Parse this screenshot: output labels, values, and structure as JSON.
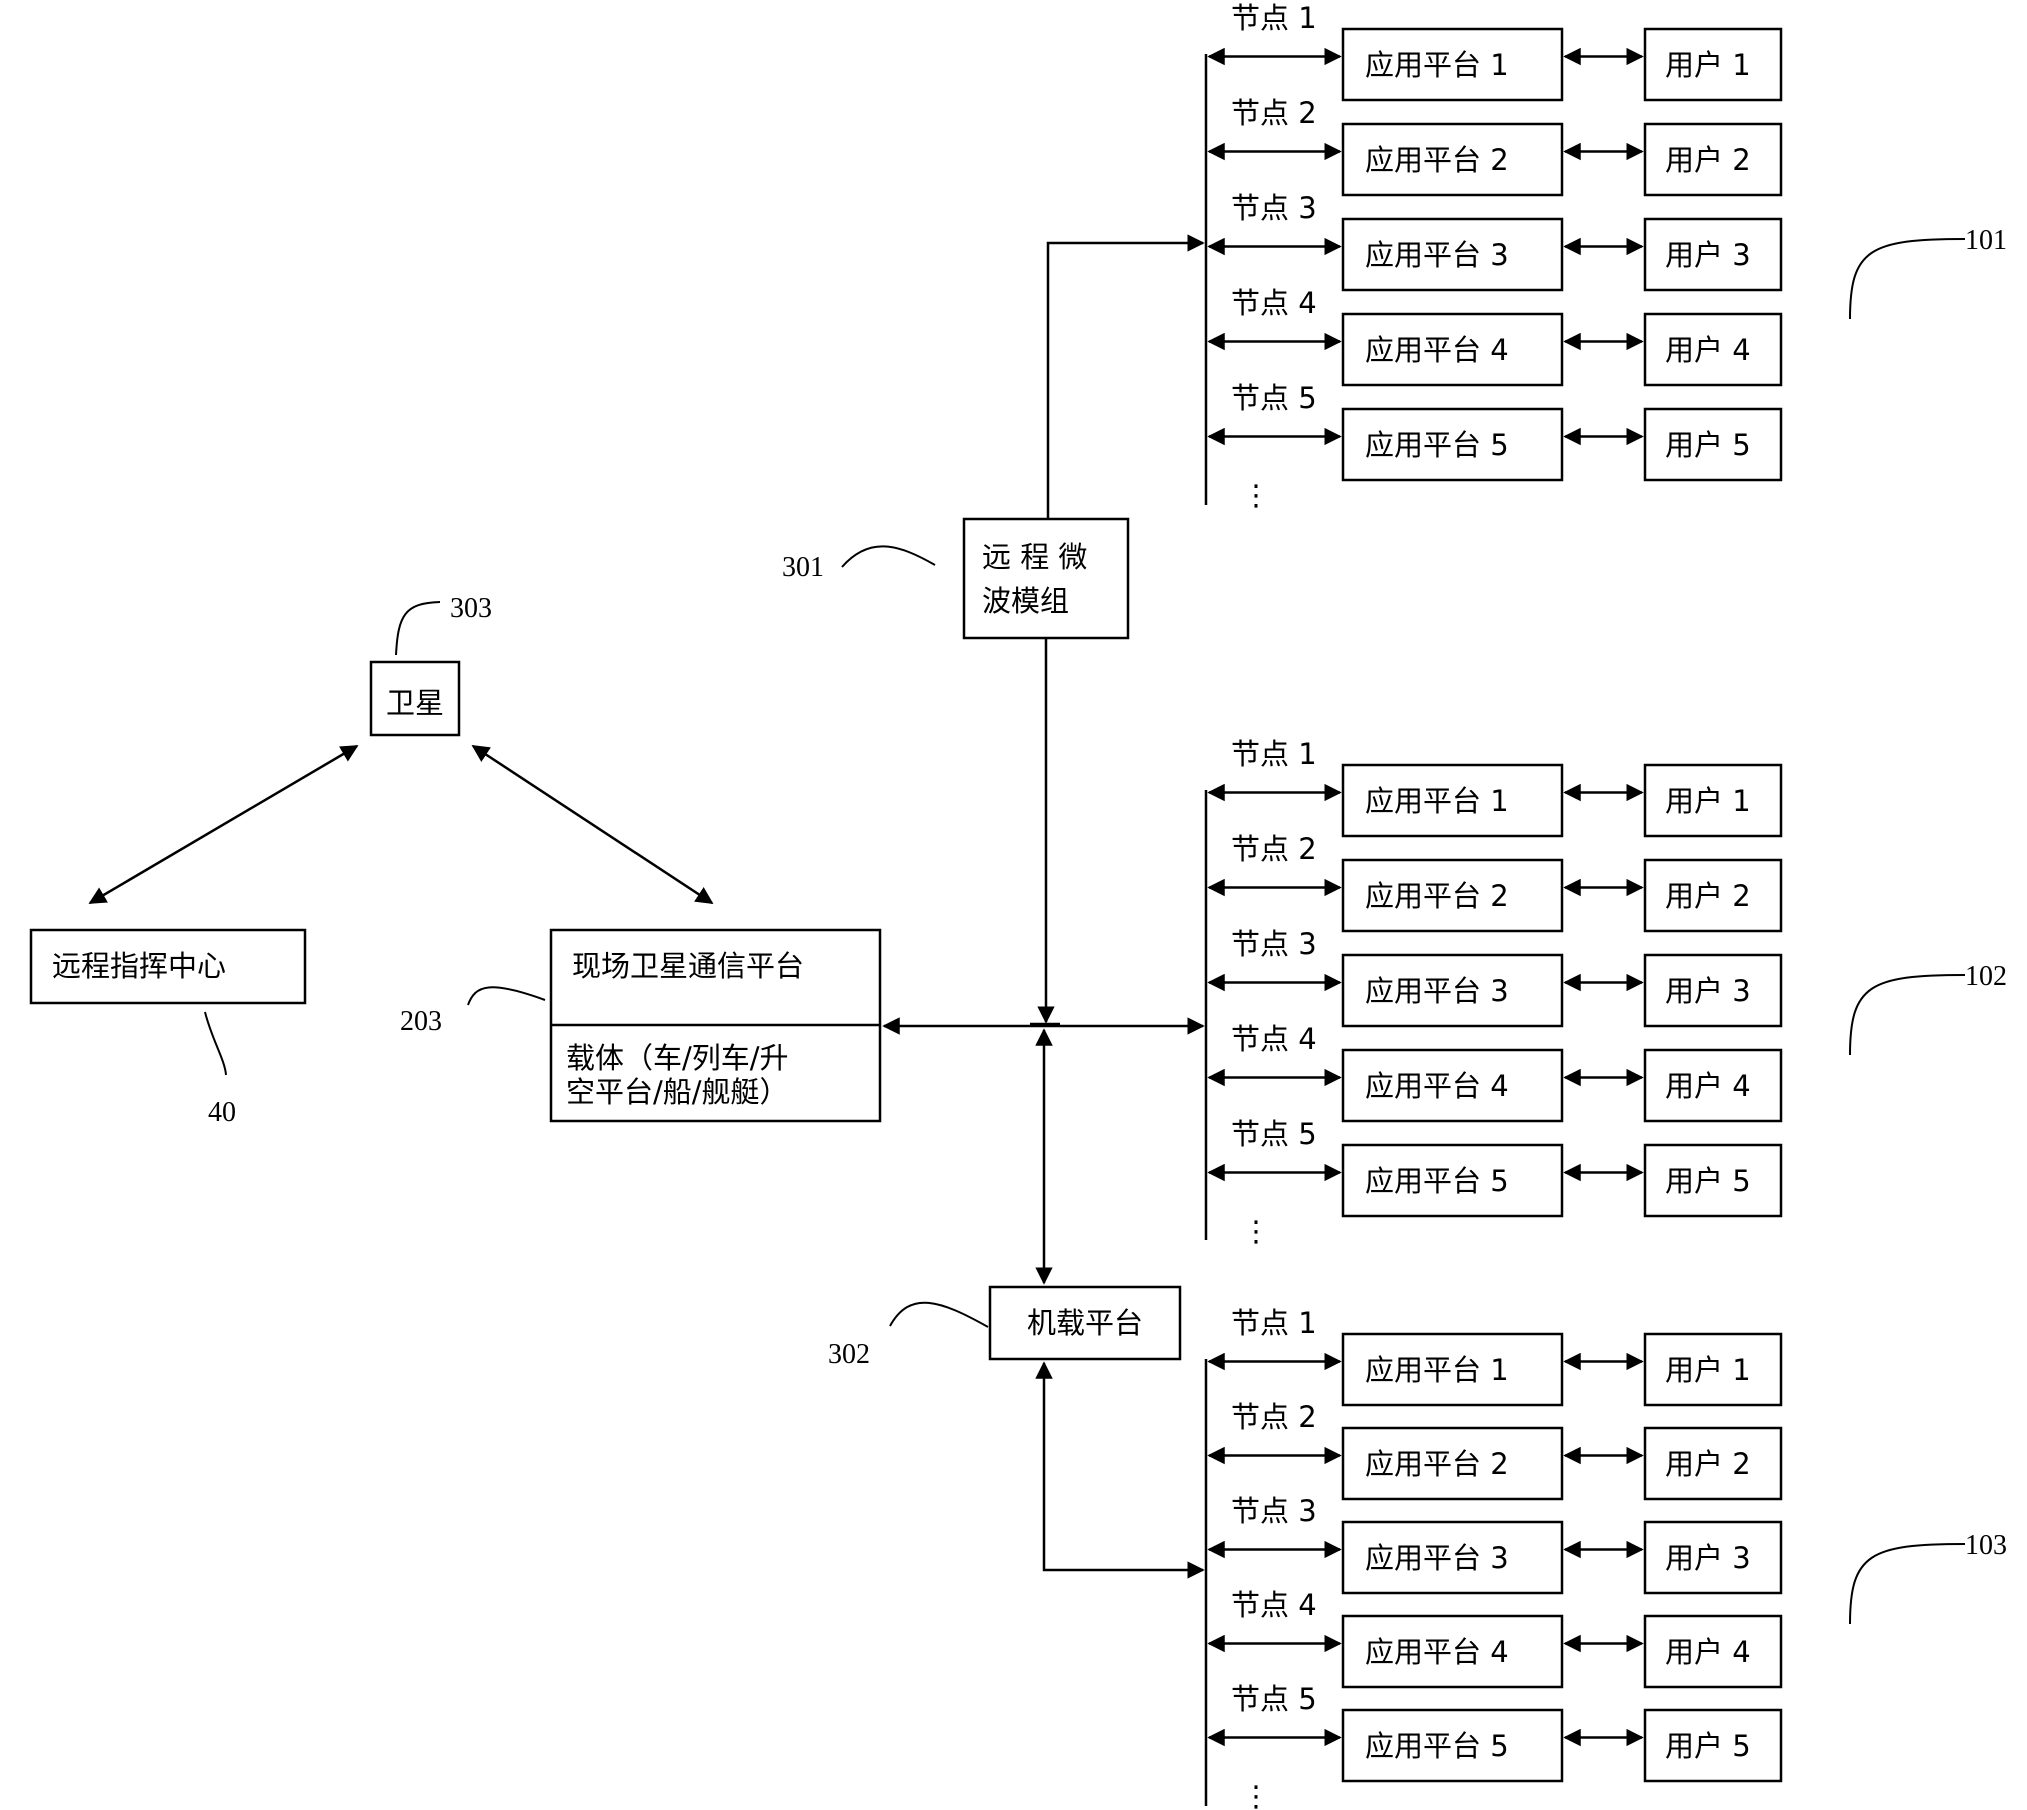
{
  "colors": {
    "stroke": "#000000",
    "background": "#ffffff"
  },
  "nodes": {
    "satellite": {
      "label": "卫星",
      "ref": "303"
    },
    "command_center": {
      "label": "远程指挥中心",
      "ref": "40"
    },
    "onsite_platform": {
      "title": "现场卫星通信平台",
      "carrier_line1": "载体（车/列车/升",
      "carrier_line2": "空平台/船/舰艇）",
      "ref": "203"
    },
    "microwave": {
      "line1": "远 程 微",
      "line2": "波模组",
      "ref": "301"
    },
    "airborne": {
      "label": "机载平台",
      "ref": "302"
    }
  },
  "groups": [
    {
      "ref": "101",
      "rows": [
        {
          "node": "节点 1",
          "app": "应用平台 1",
          "user": "用户 1"
        },
        {
          "node": "节点 2",
          "app": "应用平台 2",
          "user": "用户 2"
        },
        {
          "node": "节点 3",
          "app": "应用平台 3",
          "user": "用户 3"
        },
        {
          "node": "节点 4",
          "app": "应用平台 4",
          "user": "用户 4"
        },
        {
          "node": "节点 5",
          "app": "应用平台 5",
          "user": "用户 5"
        }
      ],
      "ellipsis": "⋮"
    },
    {
      "ref": "102",
      "rows": [
        {
          "node": "节点 1",
          "app": "应用平台 1",
          "user": "用户 1"
        },
        {
          "node": "节点 2",
          "app": "应用平台 2",
          "user": "用户 2"
        },
        {
          "node": "节点 3",
          "app": "应用平台 3",
          "user": "用户 3"
        },
        {
          "node": "节点 4",
          "app": "应用平台 4",
          "user": "用户 4"
        },
        {
          "node": "节点 5",
          "app": "应用平台 5",
          "user": "用户 5"
        }
      ],
      "ellipsis": "⋮"
    },
    {
      "ref": "103",
      "rows": [
        {
          "node": "节点 1",
          "app": "应用平台 1",
          "user": "用户 1"
        },
        {
          "node": "节点 2",
          "app": "应用平台 2",
          "user": "用户 2"
        },
        {
          "node": "节点 3",
          "app": "应用平台 3",
          "user": "用户 3"
        },
        {
          "node": "节点 4",
          "app": "应用平台 4",
          "user": "用户 4"
        },
        {
          "node": "节点 5",
          "app": "应用平台 5",
          "user": "用户 5"
        }
      ],
      "ellipsis": "⋮"
    }
  ]
}
